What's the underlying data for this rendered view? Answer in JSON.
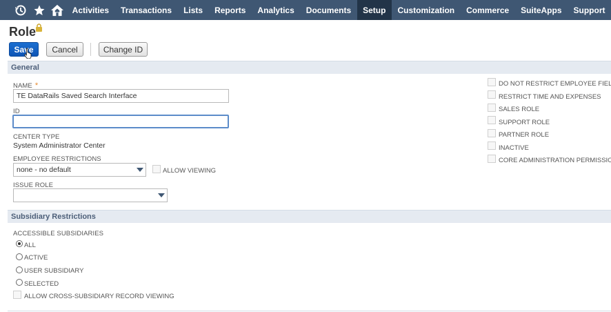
{
  "nav": {
    "icons": [
      "recent-icon",
      "star-icon",
      "home-icon"
    ],
    "items": [
      {
        "label": "Activities",
        "active": false
      },
      {
        "label": "Transactions",
        "active": false
      },
      {
        "label": "Lists",
        "active": false
      },
      {
        "label": "Reports",
        "active": false
      },
      {
        "label": "Analytics",
        "active": false
      },
      {
        "label": "Documents",
        "active": false
      },
      {
        "label": "Setup",
        "active": true
      },
      {
        "label": "Customization",
        "active": false
      },
      {
        "label": "Commerce",
        "active": false
      },
      {
        "label": "SuiteApps",
        "active": false
      },
      {
        "label": "Support",
        "active": false
      }
    ]
  },
  "page": {
    "title": "Role"
  },
  "buttons": {
    "save": "Save",
    "cancel": "Cancel",
    "change_id": "Change ID"
  },
  "general": {
    "heading": "General",
    "name_label": "NAME",
    "required_mark": "*",
    "name_value": "TE DataRails Saved Search Interface",
    "id_label": "ID",
    "id_value": "",
    "center_type_label": "CENTER TYPE",
    "center_type_value": "System Administrator Center",
    "employee_restrictions_label": "EMPLOYEE RESTRICTIONS",
    "employee_restrictions_value": "none - no default",
    "allow_viewing_label": "ALLOW VIEWING",
    "issue_role_label": "ISSUE ROLE",
    "issue_role_value": ""
  },
  "right_checkboxes": [
    {
      "label": "DO NOT RESTRICT EMPLOYEE FIELDS",
      "checked": false
    },
    {
      "label": "RESTRICT TIME AND EXPENSES",
      "checked": false
    },
    {
      "label": "SALES ROLE",
      "checked": false
    },
    {
      "label": "SUPPORT ROLE",
      "checked": false
    },
    {
      "label": "PARTNER ROLE",
      "checked": false
    },
    {
      "label": "INACTIVE",
      "checked": false
    },
    {
      "label": "CORE ADMINISTRATION PERMISSIONS",
      "checked": false
    }
  ],
  "subsidiary": {
    "heading": "Subsidiary Restrictions",
    "accessible_label": "ACCESSIBLE SUBSIDIARIES",
    "options": [
      {
        "label": "ALL",
        "selected": true
      },
      {
        "label": "ACTIVE",
        "selected": false
      },
      {
        "label": "USER SUBSIDIARY",
        "selected": false
      },
      {
        "label": "SELECTED",
        "selected": false
      }
    ],
    "cross_label": "ALLOW CROSS-SUBSIDIARY RECORD VIEWING"
  }
}
